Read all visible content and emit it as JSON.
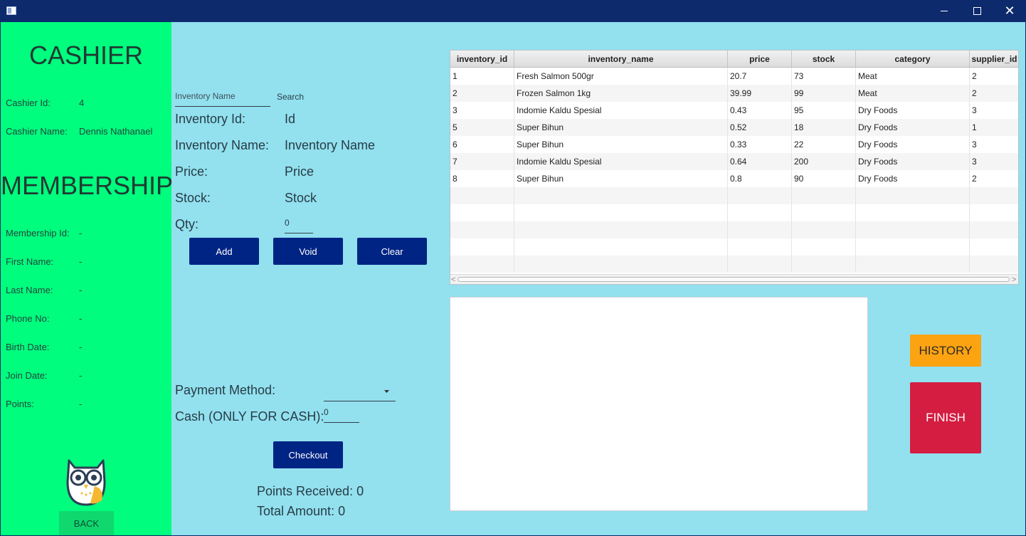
{
  "window": {
    "close_glyph": "✕"
  },
  "cashier": {
    "heading": "CASHIER",
    "id_label": "Cashier Id:",
    "id_value": "4",
    "name_label": "Cashier Name:",
    "name_value": "Dennis Nathanael"
  },
  "membership": {
    "heading": "MEMBERSHIP",
    "fields": [
      {
        "label": "Membership Id:",
        "value": "-"
      },
      {
        "label": "First Name:",
        "value": "-"
      },
      {
        "label": "Last Name:",
        "value": "-"
      },
      {
        "label": "Phone No:",
        "value": "-"
      },
      {
        "label": "Birth Date:",
        "value": "-"
      },
      {
        "label": "Join Date:",
        "value": "-"
      },
      {
        "label": "Points:",
        "value": "-"
      }
    ],
    "back_label": "BACK"
  },
  "search": {
    "placeholder": "Inventory Name",
    "button_label": "Search"
  },
  "inventory_form": {
    "id_label": "Inventory Id:",
    "id_value": "Id",
    "name_label": "Inventory Name:",
    "name_value": "Inventory Name",
    "price_label": "Price:",
    "price_value": "Price",
    "stock_label": "Stock:",
    "stock_value": "Stock",
    "qty_label": "Qty:",
    "qty_value": "0",
    "add_label": "Add",
    "void_label": "Void",
    "clear_label": "Clear"
  },
  "payment": {
    "method_label": "Payment Method:",
    "method_value": "",
    "cash_label": "Cash (ONLY FOR CASH):",
    "cash_value": "0",
    "checkout_label": "Checkout",
    "points_received": "Points Received: 0",
    "total_amount": "Total Amount: 0"
  },
  "table": {
    "columns": [
      "inventory_id",
      "inventory_name",
      "price",
      "stock",
      "category",
      "supplier_id"
    ],
    "rows": [
      [
        "1",
        "Fresh Salmon 500gr",
        "20.7",
        "73",
        "Meat",
        "2"
      ],
      [
        "2",
        "Frozen Salmon 1kg",
        "39.99",
        "99",
        "Meat",
        "2"
      ],
      [
        "3",
        "Indomie Kaldu Spesial",
        "0.43",
        "95",
        "Dry Foods",
        "3"
      ],
      [
        "5",
        "Super Bihun",
        "0.52",
        "18",
        "Dry Foods",
        "1"
      ],
      [
        "6",
        "Super Bihun",
        "0.33",
        "22",
        "Dry Foods",
        "3"
      ],
      [
        "7",
        "Indomie Kaldu Spesial",
        "0.64",
        "200",
        "Dry Foods",
        "3"
      ],
      [
        "8",
        "Super Bihun",
        "0.8",
        "90",
        "Dry Foods",
        "2"
      ]
    ],
    "scroll_left": "<",
    "scroll_right": ">"
  },
  "actions": {
    "history_label": "HISTORY",
    "finish_label": "FINISH"
  },
  "icons": {
    "app": "app-window-icon",
    "mascot": "owl-icon",
    "dropdown": "chevron-down-icon"
  }
}
